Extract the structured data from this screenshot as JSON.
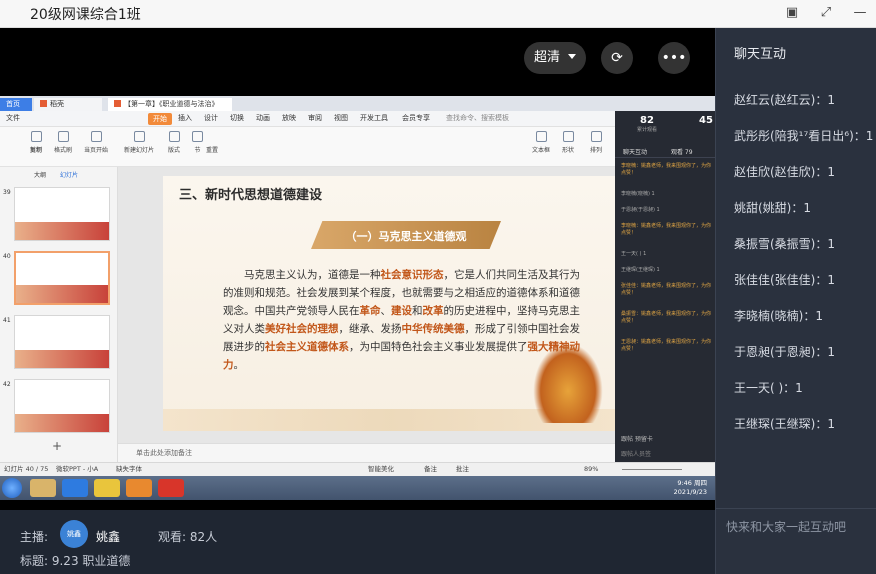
{
  "window": {
    "title": "20级网课综合1班"
  },
  "remote": {
    "tabs": [
      "首页",
      "稻壳",
      "【第一章】《职业道德与法治》"
    ],
    "menu": [
      "文件",
      "开始",
      "插入",
      "设计",
      "切换",
      "动画",
      "放映",
      "审阅",
      "视图",
      "开发工具",
      "会员专享",
      "查找命令、搜索模板"
    ],
    "ribbon": [
      "剪切",
      "复制",
      "格式刷",
      "当页开始",
      "新建幻灯片",
      "版式",
      "节",
      "重置",
      "文本框",
      "形状",
      "排列"
    ],
    "thumb_tabs": [
      "大纲",
      "幻灯片"
    ],
    "thumb_numbers": [
      "39",
      "40",
      "41",
      "42"
    ],
    "slide": {
      "heading": "三、新时代思想道德建设",
      "subtitle": "（一）马克思主义道德观",
      "body_parts": [
        {
          "text": "马克思主义认为，道德是一种",
          "hl": false
        },
        {
          "text": "社会意识形态",
          "hl": true
        },
        {
          "text": "，它是人们共同生活及其行为的准则和规范。社会发展到某个程度，也就需要与之相适应的道德体系和道德观念。中国共产党领导人民在",
          "hl": false
        },
        {
          "text": "革命",
          "hl": true
        },
        {
          "text": "、",
          "hl": false
        },
        {
          "text": "建设",
          "hl": true
        },
        {
          "text": "和",
          "hl": false
        },
        {
          "text": "改革",
          "hl": true
        },
        {
          "text": "的历史进程中，坚持马克思主义对人类",
          "hl": false
        },
        {
          "text": "美好社会的理想",
          "hl": true
        },
        {
          "text": "，继承、发扬",
          "hl": false
        },
        {
          "text": "中华传统美德",
          "hl": true
        },
        {
          "text": "，形成了引领中国社会发展进步的",
          "hl": false
        },
        {
          "text": "社会主义道德体系",
          "hl": true
        },
        {
          "text": "，为中国特色社会主义事业发展提供了",
          "hl": false
        },
        {
          "text": "强大精神动力",
          "hl": true
        },
        {
          "text": "。",
          "hl": false
        }
      ]
    },
    "notes_placeholder": "单击此处添加备注",
    "status": {
      "slide_count": "幻灯片 40 / 75",
      "theme": "微软PPT - 小A",
      "font_missing": "缺失字体",
      "beautify": "智能美化",
      "notes": "备注",
      "comments": "批注",
      "zoom": "89%"
    },
    "clock": {
      "time": "9:46 周四",
      "date": "2021/9/23"
    },
    "panel": {
      "stat_viewers": "82",
      "stat_viewers_label": "累计观看",
      "stat_other": "45",
      "tab_chat": "聊天互动",
      "tab_views": "观看 79",
      "messages": [
        {
          "text": "李晓楠：姚鑫老师，我来围观你了，为你点赞！",
          "gray": false
        },
        {
          "text": "李晓楠(晓楠) 1",
          "gray": true
        },
        {
          "text": "于恩昶(于恩昶) 1",
          "gray": true
        },
        {
          "text": "李晓楠：姚鑫老师，我来围观你了，为你点赞！",
          "gray": false
        },
        {
          "text": "王一天(   ) 1",
          "gray": true
        },
        {
          "text": "王继琛(王继琛) 1",
          "gray": true
        },
        {
          "text": "张佳佳：姚鑫老师，我来围观你了，为你点赞！",
          "gray": false
        },
        {
          "text": "桑振雪：姚鑫老师，我来围观你了，为你点赞！",
          "gray": false
        },
        {
          "text": "王恩昶：姚鑫老师，我来围观你了，为你点赞！",
          "gray": false
        }
      ],
      "footer": "跟帖  预留卡",
      "input": "跟帖人员签"
    }
  },
  "controls": {
    "quality": "超清",
    "rotate_icon": "rotate-icon",
    "more_icon": "more-icon"
  },
  "info": {
    "host_label": "主播:",
    "host_avatar": "姚鑫",
    "host_name": "姚鑫",
    "viewers": "观看: 82人",
    "topic": "标题: 9.23 职业道德"
  },
  "chat": {
    "title": "聊天互动",
    "items": [
      "赵红云(赵红云)：1",
      "武彤彤(陪我¹⁷看日出⁶)：1",
      "赵佳欣(赵佳欣)：1",
      "姚甜(姚甜)：1",
      "桑振雪(桑振雪)：1",
      "张佳佳(张佳佳)：1",
      "李晓楠(晓楠)：1",
      "于恩昶(于恩昶)：1",
      "王一天(   )：1",
      "王继琛(王继琛)：1"
    ],
    "input_placeholder": "快来和大家一起互动吧"
  }
}
